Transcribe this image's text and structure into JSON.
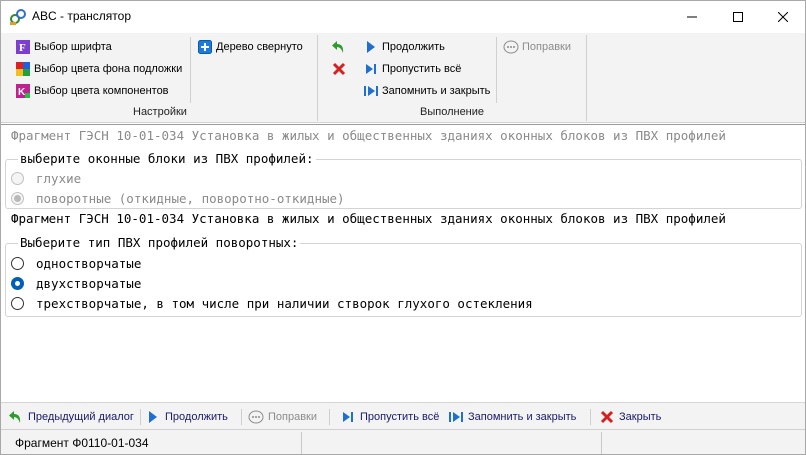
{
  "window": {
    "title": "ABC - транслятор"
  },
  "ribbon": {
    "settings": {
      "label": "Настройки",
      "font_button": "Выбор шрифта",
      "bg_color_button": "Выбор цвета фона подложки",
      "component_color_button": "Выбор цвета компонентов",
      "tree_collapsed_button": "Дерево свернуто"
    },
    "execution": {
      "label": "Выполнение",
      "continue_button": "Продолжить",
      "skip_all_button": "Пропустить всё",
      "remember_close_button": "Запомнить и закрыть",
      "corrections_button": "Поправки"
    }
  },
  "content": {
    "fragment_1": "Фрагмент ГЭСН 10-01-034 Установка в жилых и общественных зданиях оконных блоков из ПВХ профилей",
    "group_1": {
      "legend": "выберите оконные блоки из ПВХ профилей:",
      "options": [
        {
          "label": "глухие",
          "checked": false
        },
        {
          "label": "поворотные (откидные, поворотно-откидные)",
          "checked": true
        }
      ]
    },
    "fragment_2": "Фрагмент ГЭСН 10-01-034 Установка в жилых и общественных зданиях оконных блоков из ПВХ профилей",
    "group_2": {
      "legend": "Выберите тип ПВХ профилей поворотных:",
      "options": [
        {
          "label": "одностворчатые",
          "checked": false
        },
        {
          "label": "двухстворчатые",
          "checked": true
        },
        {
          "label": "трехстворчатые, в том числе при наличии створок глухого остекления",
          "checked": false
        }
      ]
    }
  },
  "toolbar": {
    "prev_dialog": "Предыдущий диалог",
    "continue": "Продолжить",
    "corrections": "Поправки",
    "skip_all": "Пропустить всё",
    "remember_close": "Запомнить и закрыть",
    "close": "Закрыть"
  },
  "status": {
    "fragment": "Фрагмент  Ф0110-01-034"
  },
  "colors": {
    "accent": "#005fb8",
    "play_blue": "#1e6fd0",
    "close_red": "#d62020",
    "arrow_green": "#2e9b2e"
  }
}
